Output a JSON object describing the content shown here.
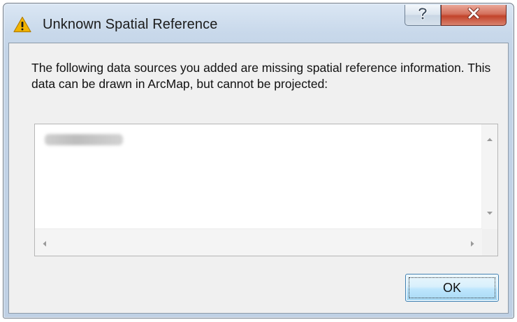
{
  "window": {
    "title": "Unknown Spatial Reference",
    "title_icon": "warning-icon",
    "help_symbol": "?",
    "close_symbol": "✕"
  },
  "dialog": {
    "message": "The following data sources you added are missing spatial reference information. This data can be drawn in ArcMap, but cannot be projected:",
    "data_sources": [
      {
        "label": "",
        "blurred": true
      }
    ],
    "ok_label": "OK"
  },
  "colors": {
    "close_button": "#c2432a",
    "ok_button_border": "#3c7fb1",
    "warning_fill": "#f2b400"
  }
}
